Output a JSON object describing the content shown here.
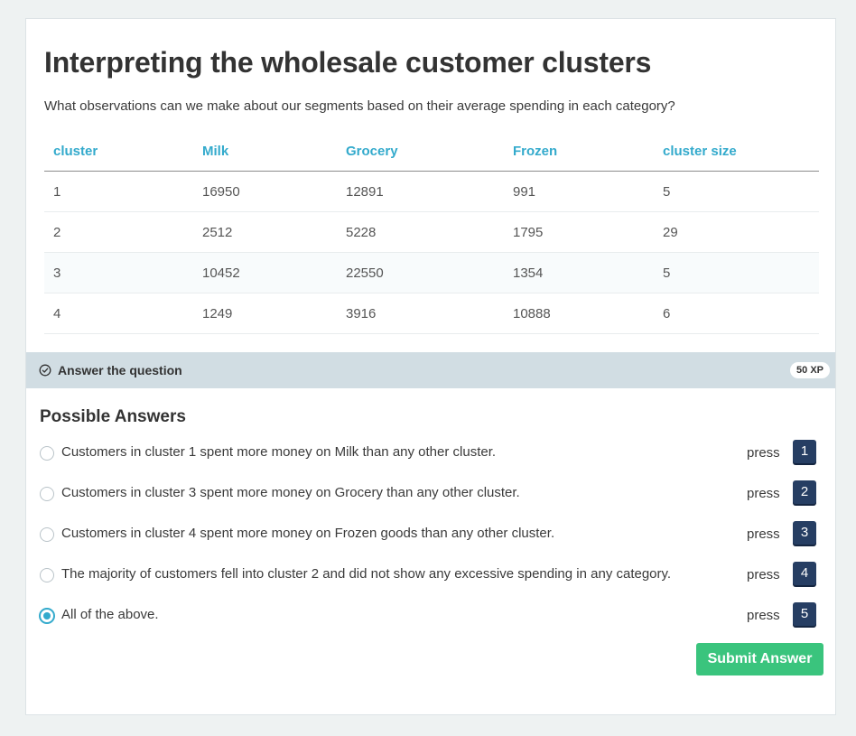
{
  "exercise": {
    "title": "Interpreting the wholesale customer clusters",
    "question": "What observations can we make about our segments based on their average spending in each category?"
  },
  "table": {
    "headers": [
      "cluster",
      "Milk",
      "Grocery",
      "Frozen",
      "cluster size"
    ],
    "rows": [
      [
        "1",
        "16950",
        "12891",
        "991",
        "5"
      ],
      [
        "2",
        "2512",
        "5228",
        "1795",
        "29"
      ],
      [
        "3",
        "10452",
        "22550",
        "1354",
        "5"
      ],
      [
        "4",
        "1249",
        "3916",
        "10888",
        "6"
      ]
    ]
  },
  "answer_bar": {
    "label": "Answer the question",
    "xp": "50 XP",
    "icon": "check-circle-icon"
  },
  "answers": {
    "heading": "Possible Answers",
    "press_label": "press",
    "selected_index": 4,
    "options": [
      {
        "text": "Customers in cluster 1 spent more money on Milk than any other cluster.",
        "key": "1"
      },
      {
        "text": "Customers in cluster 3 spent more money on Grocery than any other cluster.",
        "key": "2"
      },
      {
        "text": "Customers in cluster 4 spent more money on Frozen goods than any other cluster.",
        "key": "3"
      },
      {
        "text": "The majority of customers fell into cluster 2 and did not show any excessive spending in any category.",
        "key": "4"
      },
      {
        "text": "All of the above.",
        "key": "5"
      }
    ]
  },
  "submit": {
    "label": "Submit Answer"
  },
  "colors": {
    "accent": "#33aacc",
    "key_badge": "#263e63",
    "submit": "#3ac47d",
    "answer_bar": "#d1dde3"
  }
}
